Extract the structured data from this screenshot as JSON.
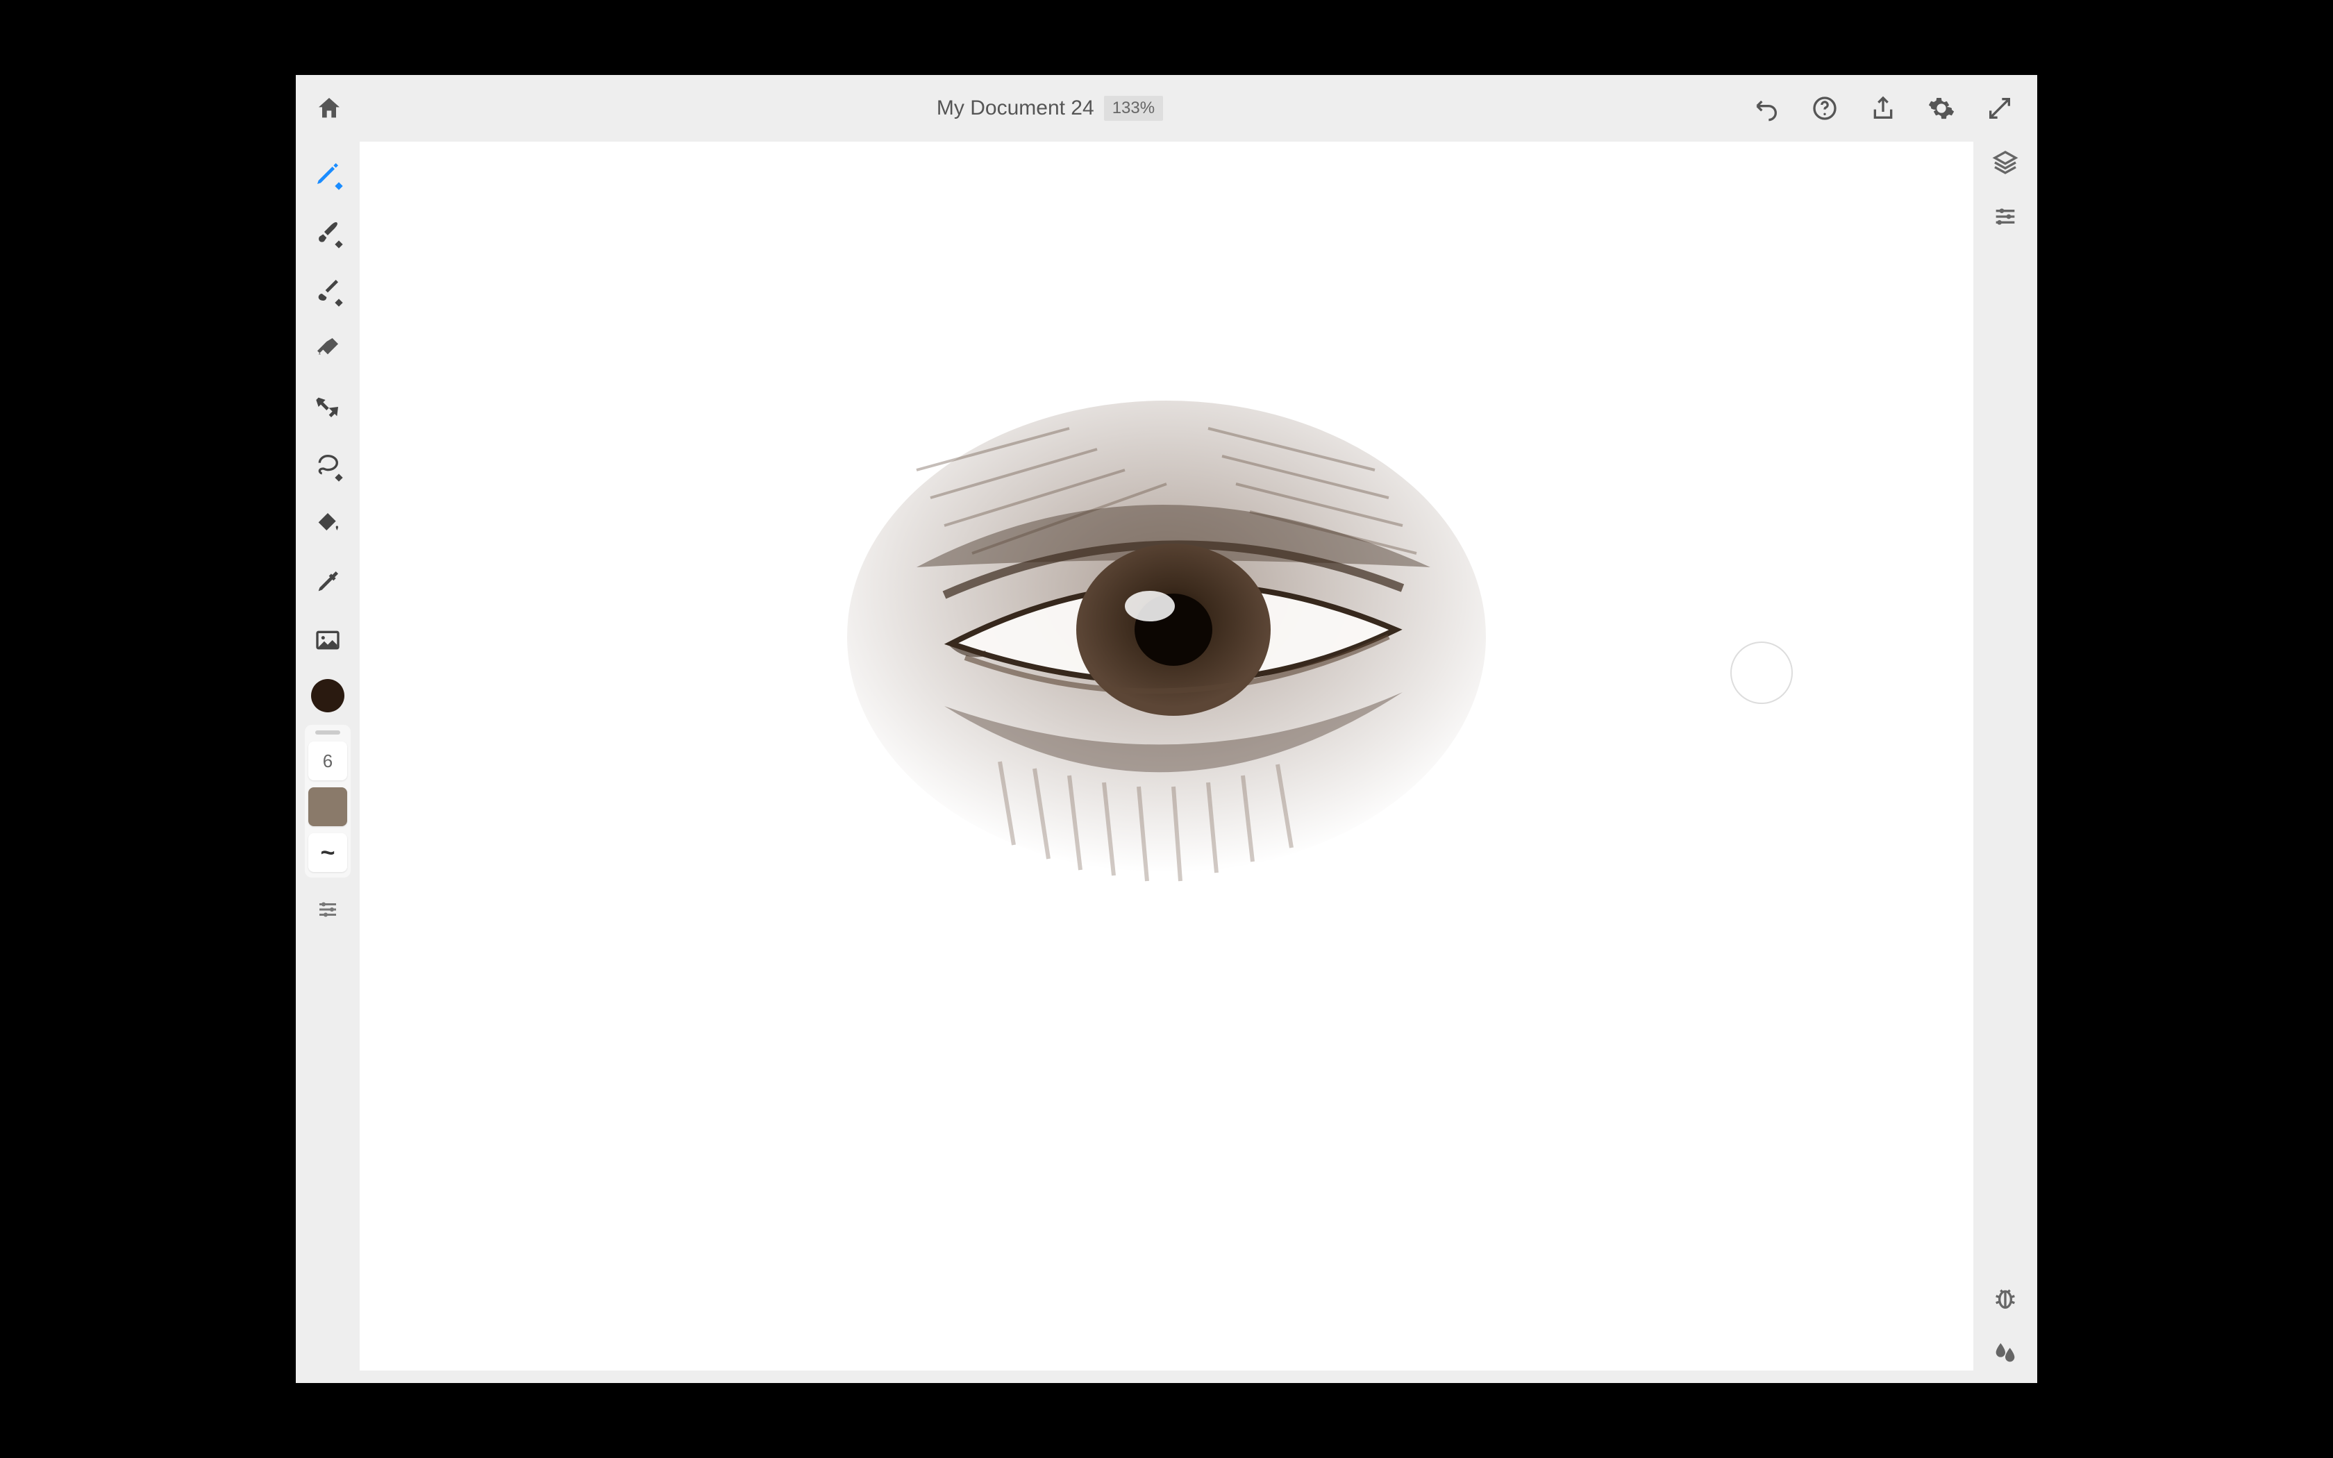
{
  "document": {
    "title": "My Document 24",
    "zoom_label": "133%"
  },
  "toolbar_left": {
    "home": "home",
    "tools": [
      {
        "name": "pixel-brush",
        "icon": "pencil-icon",
        "active": true
      },
      {
        "name": "eraser-brush",
        "icon": "brush-icon",
        "active": false
      },
      {
        "name": "brush-3",
        "icon": "brush-alt-icon",
        "active": false
      },
      {
        "name": "eraser",
        "icon": "eraser-icon",
        "active": false
      },
      {
        "name": "move",
        "icon": "move-icon",
        "active": false
      },
      {
        "name": "lasso",
        "icon": "lasso-icon",
        "active": false
      },
      {
        "name": "bucket",
        "icon": "bucket-icon",
        "active": false
      },
      {
        "name": "eyedropper",
        "icon": "eyedropper-icon",
        "active": false
      },
      {
        "name": "image",
        "icon": "image-icon",
        "active": false
      }
    ],
    "current_color": "#2a1a10",
    "brush_size": "6",
    "brush_preview_color": "#8a7a6a"
  },
  "toolbar_top_right": {
    "items": [
      "undo",
      "help",
      "share",
      "settings",
      "fullscreen"
    ]
  },
  "toolbar_right": {
    "top": [
      "layers",
      "adjustments"
    ],
    "bottom": [
      "bug",
      "water-blend"
    ]
  },
  "canvas_content": "pencil sketch of a human eye"
}
